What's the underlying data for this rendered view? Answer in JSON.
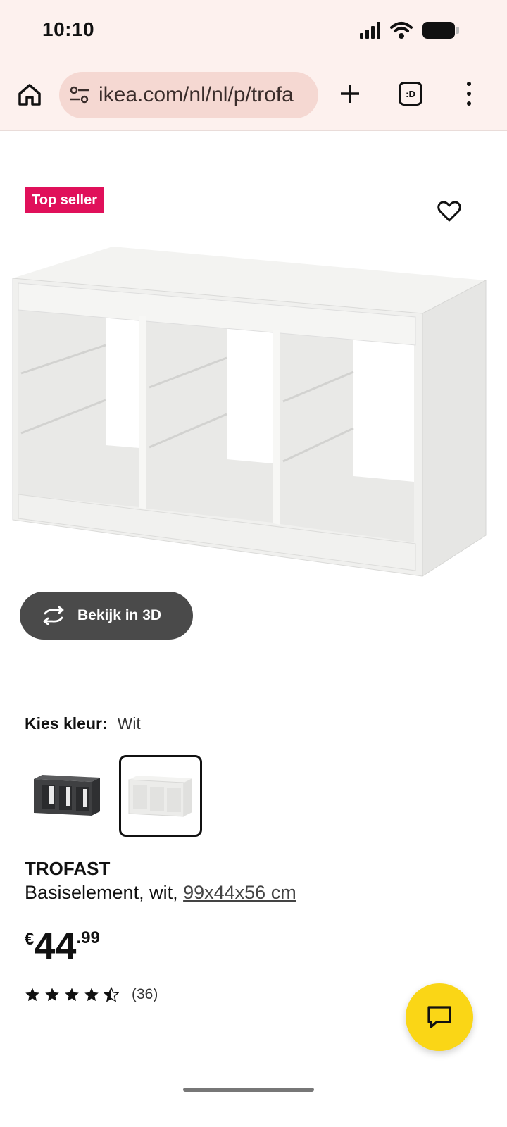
{
  "status_bar": {
    "time": "10:10"
  },
  "browser": {
    "url": "ikea.com/nl/nl/p/trofa",
    "tabs_label": ":D",
    "icons": {
      "home": "home-icon",
      "site_settings": "tune-icon",
      "new_tab": "plus-icon",
      "tabs": "tabs-icon",
      "menu": "more-vert-icon"
    }
  },
  "product": {
    "badge": "Top seller",
    "view_3d_label": "Bekijk in 3D",
    "color_label": "Kies kleur:",
    "color_value": "Wit",
    "swatches": [
      {
        "name": "swatch-black",
        "color": "#3f4042",
        "selected": false
      },
      {
        "name": "swatch-white",
        "color": "#f4f4f2",
        "selected": true
      }
    ],
    "name": "TROFAST",
    "description": "Basiselement, wit, ",
    "size": "99x44x56 cm",
    "price": {
      "currency": "€",
      "integer": "44",
      "decimals": ".99"
    },
    "rating": {
      "stars": 4.5,
      "count": "(36)"
    }
  },
  "colors": {
    "badge": "#e0105a",
    "chat_fab": "#fad616",
    "button_3d": "#4a4a4a",
    "chrome": "#fdf1ee",
    "urlbar": "#f5d8d2"
  }
}
